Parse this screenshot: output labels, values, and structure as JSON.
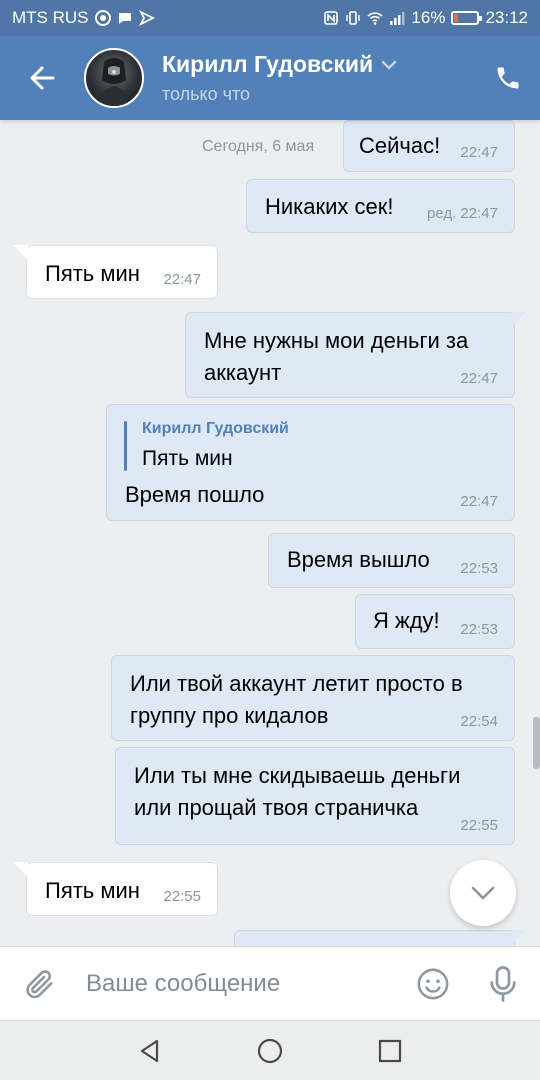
{
  "status_bar": {
    "carrier": "MTS RUS",
    "battery_percent": "16%",
    "battery_level": 0.16,
    "time": "23:12"
  },
  "header": {
    "contact_name": "Кирилл Гудовский",
    "contact_status": "только что"
  },
  "chat": {
    "date_divider": "Сегодня, 6 мая",
    "messages": [
      {
        "direction": "out",
        "text": "Сейчас!",
        "time": "22:47",
        "edited": ""
      },
      {
        "direction": "out",
        "text": "Никаких сек!",
        "time": "22:47",
        "edited": "ред."
      },
      {
        "direction": "in",
        "text": "Пять мин",
        "time": "22:47",
        "edited": ""
      },
      {
        "direction": "out",
        "text_lines": [
          "Мне нужны мои деньги за",
          "аккаунт"
        ],
        "time": "22:47",
        "edited": ""
      },
      {
        "direction": "out",
        "reply": {
          "author": "Кирилл Гудовский",
          "text": "Пять мин"
        },
        "text": "Время пошло",
        "time": "22:47",
        "edited": ""
      },
      {
        "direction": "out",
        "text": "Время вышло",
        "time": "22:53",
        "edited": ""
      },
      {
        "direction": "out",
        "text": "Я жду!",
        "time": "22:53",
        "edited": ""
      },
      {
        "direction": "out",
        "text_lines": [
          "Или твой аккаунт летит просто в",
          "группу про кидалов"
        ],
        "time": "22:54",
        "edited": ""
      },
      {
        "direction": "out",
        "text_lines": [
          "Или ты мне скидываешь деньги",
          "или прощай твоя страничка"
        ],
        "time": "22:55",
        "edited": ""
      },
      {
        "direction": "in",
        "text": "Пять мин",
        "time": "22:55",
        "edited": ""
      }
    ]
  },
  "input": {
    "placeholder": "Ваше сообщение"
  },
  "colors": {
    "header": "#5181b8",
    "status_bar": "#4f76a6",
    "outgoing_bubble": "#dfe9f6",
    "incoming_bubble": "#ffffff",
    "background": "#edeef0",
    "accent": "#5181b8",
    "muted_text": "#818c99"
  },
  "icons": {
    "back": "arrow-left-icon",
    "call": "phone-icon",
    "dropdown": "chevron-down-icon",
    "attach": "paperclip-icon",
    "emoji": "smile-icon",
    "voice": "microphone-icon",
    "scroll_down": "chevron-down-icon",
    "nav_back": "triangle-back-icon",
    "nav_home": "circle-home-icon",
    "nav_recent": "square-recent-icon"
  }
}
